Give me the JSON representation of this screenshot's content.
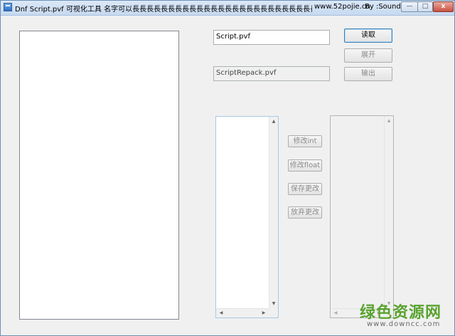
{
  "window": {
    "title": "Dnf Script.pvf 可视化工具 名字可以長長長長長長長長長長長長長長長長長長長長長長長長長長長長長長長長長一點",
    "url": "www.52pojie.cn",
    "author": "By :Sound",
    "controls": {
      "minimize": "—",
      "maximize": "□",
      "close": "x"
    }
  },
  "inputs": {
    "script_file": "Script.pvf",
    "repack_file": "ScriptRepack.pvf"
  },
  "buttons": {
    "read": "读取",
    "expand": "展开",
    "output": "输出",
    "modify_int": "修改int",
    "modify_float": "修改float",
    "save_changes": "保存更改",
    "discard_changes": "放弃更改"
  },
  "scrollbar_arrows": {
    "up": "▲",
    "down": "▼",
    "left": "◀",
    "right": "▶"
  },
  "watermark": {
    "brand": "绿色资源网",
    "site": "www.downcc.com"
  }
}
